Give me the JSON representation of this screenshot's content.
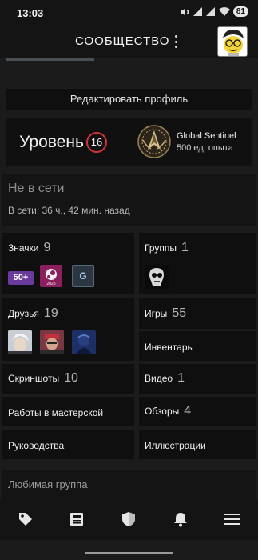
{
  "status_bar": {
    "time": "13:03",
    "battery": "81"
  },
  "header": {
    "title": "СООБЩЕСТВО",
    "menu_icon": "kebab-menu-icon",
    "avatar_icon": "avatar-lemon-character"
  },
  "profile": {
    "edit_button": "Редактировать профиль",
    "level_label": "Уровень",
    "level_value": "16",
    "badge_name": "Global Sentinel",
    "badge_xp": "500 ед. опыта",
    "status": "Не в сети",
    "online_time": "В сети: 36 ч., 42 мин. назад"
  },
  "tiles": {
    "badges": {
      "label": "Значки",
      "count": "9",
      "items": [
        "50+",
        "2025",
        "G"
      ]
    },
    "groups": {
      "label": "Группы",
      "count": "1"
    },
    "friends": {
      "label": "Друзья",
      "count": "19"
    },
    "games": {
      "label": "Игры",
      "count": "55"
    },
    "inventory": {
      "label": "Инвентарь"
    },
    "screenshots": {
      "label": "Скриншоты",
      "count": "10"
    },
    "videos": {
      "label": "Видео",
      "count": "1"
    },
    "workshop": {
      "label": "Работы в мастерской"
    },
    "reviews": {
      "label": "Обзоры",
      "count": "4"
    },
    "guides": {
      "label": "Руководства"
    },
    "artwork": {
      "label": "Иллюстрации"
    }
  },
  "favorite_group": {
    "label": "Любимая группа"
  },
  "bottom_nav": [
    "tag-icon",
    "news-icon",
    "shield-icon",
    "bell-icon",
    "hamburger-icon"
  ],
  "colors": {
    "level_ring": "#d2333a",
    "background": "#1b1b1c",
    "tile": "#0f0f10"
  }
}
